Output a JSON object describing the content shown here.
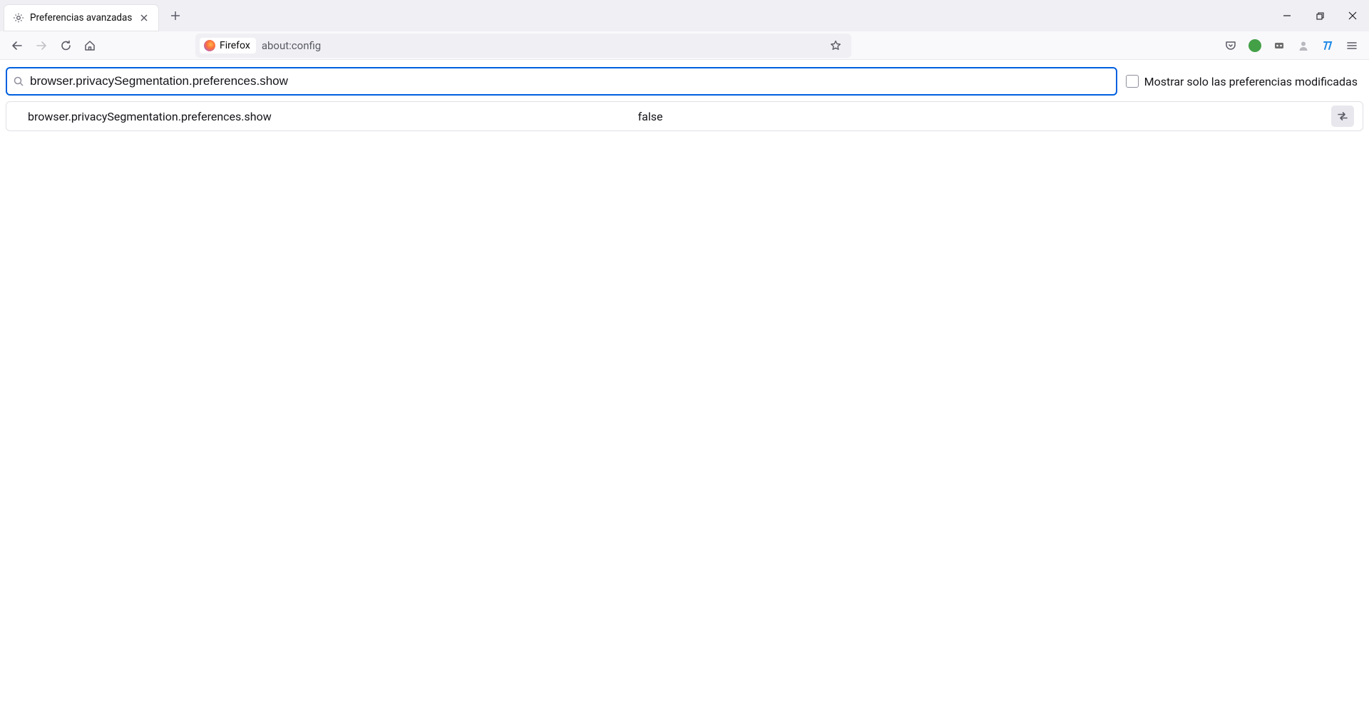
{
  "tab": {
    "title": "Preferencias avanzadas"
  },
  "urlbar": {
    "identity_label": "Firefox",
    "url": "about:config"
  },
  "aboutconfig": {
    "search_value": "browser.privacySegmentation.preferences.show",
    "filter_modified_label": "Mostrar solo las preferencias modificadas",
    "rows": [
      {
        "name": "browser.privacySegmentation.preferences.show",
        "value": "false"
      }
    ]
  }
}
